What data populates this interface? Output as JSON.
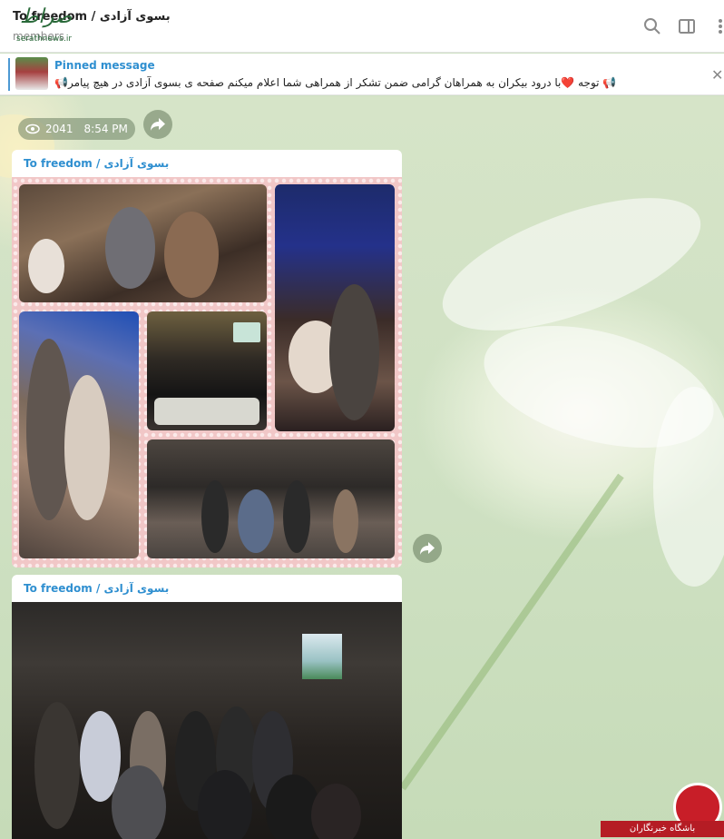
{
  "header": {
    "title": "To freedom / بسوی آزادی",
    "subtitle": "members",
    "icons": [
      "search-icon",
      "sidebar-icon",
      "more-icon"
    ]
  },
  "watermark_top": {
    "logo_text": "صراط",
    "url": "serathnews.ir"
  },
  "pinned": {
    "title": "Pinned message",
    "text": "📢 توجه ❤️با درود بیکران به همراهان گرامی  ضمن تشکر از همراهی شما اعلام میکنم  صفحه ی بسوی آزادی در هیچ پیامر📢"
  },
  "message_meta": {
    "views": "2041",
    "time": "8:54 PM"
  },
  "posts": [
    {
      "author": "To freedom / بسوی آزادی"
    },
    {
      "author": "To freedom / بسوی آزادی"
    }
  ],
  "watermark_bottom": {
    "text": "باشگاه خبرنگاران"
  },
  "colors": {
    "accent": "#2f8fd0",
    "header_bg": "#ffffff",
    "pinned_border": "#4d99d3",
    "watermark_red": "#c81e28"
  }
}
